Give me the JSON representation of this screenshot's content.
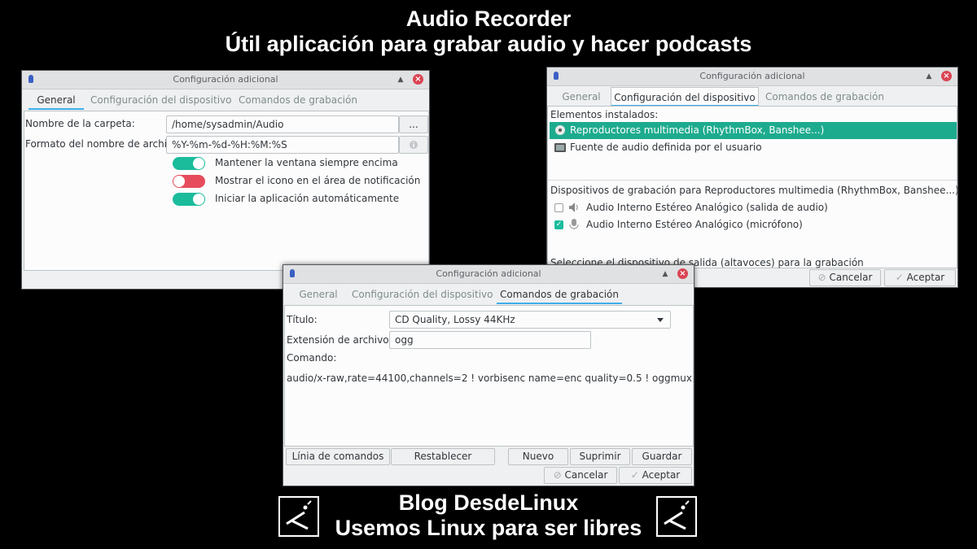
{
  "banner": {
    "title": "Audio Recorder",
    "subtitle": "Útil aplicación para grabar audio y hacer podcasts",
    "footer_title": "Blog DesdeLinux",
    "footer_subtitle": "Usemos Linux para ser libres"
  },
  "dialog_general": {
    "title": "Configuración adicional",
    "tabs": [
      "General",
      "Configuración del dispositivo",
      "Comandos de grabación"
    ],
    "folder_label": "Nombre de la carpeta:",
    "folder_value": "/home/sysadmin/Audio",
    "browse_label": "...",
    "format_label": "Formato del nombre de archivo:",
    "format_value": "%Y-%m-%d-%H:%M:%S",
    "toggles": [
      {
        "label": "Mantener la ventana siempre encima",
        "on": true
      },
      {
        "label": "Mostrar el icono en el área de notificación",
        "on": false
      },
      {
        "label": "Iniciar la aplicación automáticamente",
        "on": true
      }
    ]
  },
  "dialog_device": {
    "title": "Configuración adicional",
    "tabs": [
      "General",
      "Configuración del dispositivo",
      "Comandos de grabación"
    ],
    "installed_label": "Elementos instalados:",
    "installed_items": [
      "Reproductores multimedia (RhythmBox, Banshee...)",
      "Fuente de audio definida por el usuario"
    ],
    "devices_label": "Dispositivos de grabación para Reproductores multimedia (RhythmBox, Banshee...):",
    "devices": [
      {
        "label": "Audio Interno Estéreo Analógico (salida de audio)",
        "checked": false
      },
      {
        "label": "Audio Interno Estéreo Analógico (micrófono)",
        "checked": true
      }
    ],
    "output_label": "Seleccione el dispositivo de salida (altavoces) para la grabación",
    "cancel_label": "Cancelar",
    "accept_label": "Aceptar"
  },
  "dialog_commands": {
    "title": "Configuración adicional",
    "tabs": [
      "General",
      "Configuración del dispositivo",
      "Comandos de grabación"
    ],
    "title_label": "Título:",
    "title_value": "CD Quality, Lossy 44KHz",
    "ext_label": "Extensión de archivo:",
    "ext_value": "ogg",
    "command_label": "Comando:",
    "command_value": "audio/x-raw,rate=44100,channels=2 ! vorbisenc name=enc quality=0.5 ! oggmux",
    "buttons": [
      "Línia de comandos",
      "Restablecer",
      "Nuevo",
      "Suprimir",
      "Guardar"
    ],
    "cancel_label": "Cancelar",
    "accept_label": "Aceptar"
  },
  "colors": {
    "accent": "#3daee9",
    "selection": "#1dab8e",
    "toggle_on": "#1abc9c",
    "toggle_off": "#e74c5c",
    "close": "#da4453"
  }
}
